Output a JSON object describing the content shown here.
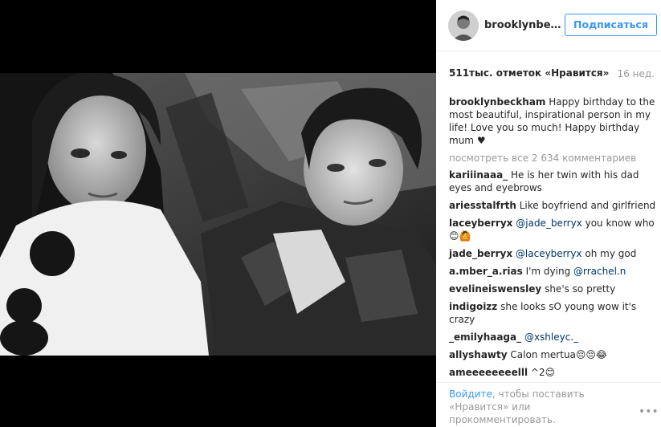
{
  "header": {
    "username": "brooklynbe…",
    "follow_label": "Подписаться"
  },
  "post": {
    "likes": "511тыс. отметок «Нравится»",
    "time_ago": "16 нед."
  },
  "caption": {
    "username": "brooklynbeckham",
    "text": "Happy birthday to the most beautiful, inspirational person in my life! Love you so much! Happy birthday mum",
    "emoji": "♥"
  },
  "view_all": "посмотреть все 2 634 комментариев",
  "comments": [
    {
      "user": "kariiinaaa_",
      "text": "He is her twin with his dad eyes and eyebrows"
    },
    {
      "user": "ariesstalfrth",
      "text": "Like boyfriend and girlfriend"
    },
    {
      "user": "laceyberryx",
      "mention": "@jade_berryx",
      "text": " you know who 😊🙆"
    },
    {
      "user": "jade_berryx",
      "mention": "@laceyberryx",
      "text": " oh my god"
    },
    {
      "user": "a.mber_a.rias",
      "text": "I'm dying ",
      "mention2": "@rrachel.n"
    },
    {
      "user": "evelineiswensley",
      "text": "she's so pretty"
    },
    {
      "user": "indigoizz",
      "text": "she looks sO young wow it's crazy"
    },
    {
      "user": "_emilyhaaga_",
      "mention": "@xshleyc._"
    },
    {
      "user": "allyshawty",
      "text": "Calon mertua😔😔😂"
    },
    {
      "user": "ameeeeeeeelll",
      "text": "^2😊"
    }
  ],
  "footer": {
    "login_label": "Войдите",
    "text": ", чтобы поставить «Нравится» или прокомментировать.",
    "more_icon": "more-dots-icon"
  },
  "colors": {
    "link_blue": "#3897f0",
    "mention_blue": "#003569",
    "muted_gray": "#999999",
    "text": "#262626"
  }
}
